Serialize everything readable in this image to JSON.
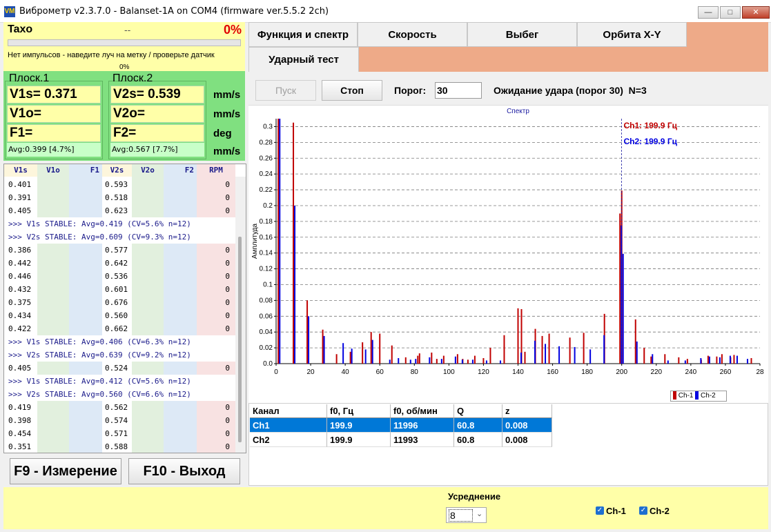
{
  "window": {
    "title": "Виброметр v2.3.7.0 - Balanset-1A on COM4 (firmware ver.5.5.2 2ch)",
    "icon": "VM",
    "controls": [
      "minimize",
      "maximize",
      "close"
    ]
  },
  "taxo": {
    "title": "Taxo",
    "rpm": "--",
    "percent": "0%",
    "message": "Нет импульсов - наведите луч на метку / проверьте датчик",
    "bar_percent_label": "0%",
    "bar_fill": 0
  },
  "plane1": {
    "title": "Плоск.1",
    "v1s": "V1s= 0.371",
    "v1o": "V1o=",
    "f1": "F1=",
    "avg": "Avg:0.399 [4.7%]"
  },
  "plane2": {
    "title": "Плоск.2",
    "v2s": "V2s= 0.539",
    "v2o": "V2o=",
    "f2": "F2=",
    "avg": "Avg:0.567 [7.7%]"
  },
  "units": [
    "mm/s",
    "mm/s",
    "deg",
    "mm/s"
  ],
  "log_table": {
    "columns": [
      "V1s",
      "V1o",
      "F1",
      "V2s",
      "V2o",
      "F2",
      "RPM"
    ],
    "rows": [
      {
        "type": "data",
        "v1s": "0.401",
        "v2s": "0.593",
        "rpm": "0"
      },
      {
        "type": "data",
        "v1s": "0.391",
        "v2s": "0.518",
        "rpm": "0"
      },
      {
        "type": "data",
        "v1s": "0.405",
        "v2s": "0.623",
        "rpm": "0"
      },
      {
        "type": "msg",
        "text": ">>> V1s STABLE: Avg=0.419 (CV=5.6% n=12)"
      },
      {
        "type": "msg",
        "text": ">>> V2s STABLE: Avg=0.609 (CV=9.3% n=12)"
      },
      {
        "type": "data",
        "v1s": "0.386",
        "v2s": "0.577",
        "rpm": "0"
      },
      {
        "type": "data",
        "v1s": "0.442",
        "v2s": "0.642",
        "rpm": "0"
      },
      {
        "type": "data",
        "v1s": "0.446",
        "v2s": "0.536",
        "rpm": "0"
      },
      {
        "type": "data",
        "v1s": "0.432",
        "v2s": "0.601",
        "rpm": "0"
      },
      {
        "type": "data",
        "v1s": "0.375",
        "v2s": "0.676",
        "rpm": "0"
      },
      {
        "type": "data",
        "v1s": "0.434",
        "v2s": "0.560",
        "rpm": "0"
      },
      {
        "type": "data",
        "v1s": "0.422",
        "v2s": "0.662",
        "rpm": "0"
      },
      {
        "type": "msg",
        "text": ">>> V1s STABLE: Avg=0.406 (CV=6.3% n=12)"
      },
      {
        "type": "msg",
        "text": ">>> V2s STABLE: Avg=0.639 (CV=9.2% n=12)"
      },
      {
        "type": "data",
        "v1s": "0.405",
        "v2s": "0.524",
        "rpm": "0"
      },
      {
        "type": "msg",
        "text": ">>> V1s STABLE: Avg=0.412 (CV=5.6% n=12)"
      },
      {
        "type": "msg",
        "text": ">>> V2s STABLE: Avg=0.560 (CV=6.6% n=12)"
      },
      {
        "type": "data",
        "v1s": "0.419",
        "v2s": "0.562",
        "rpm": "0"
      },
      {
        "type": "data",
        "v1s": "0.398",
        "v2s": "0.574",
        "rpm": "0"
      },
      {
        "type": "data",
        "v1s": "0.454",
        "v2s": "0.571",
        "rpm": "0"
      },
      {
        "type": "data",
        "v1s": "0.351",
        "v2s": "0.588",
        "rpm": "0"
      }
    ]
  },
  "fkeys": {
    "measure": "F9 - Измерение",
    "exit": "F10 - Выход"
  },
  "tabs": {
    "func_spectrum": "Функция и спектр",
    "speed": "Скорость",
    "rundown": "Выбег",
    "orbit": "Орбита X-Y",
    "impact": "Ударный тест"
  },
  "toolbar": {
    "start": "Пуск",
    "stop": "Стоп",
    "threshold_label": "Порог:",
    "threshold_value": "30",
    "status": "Ожидание удара (порог 30)  N=3"
  },
  "results": {
    "columns": [
      "Канал",
      "f0, Гц",
      "f0, об/мин",
      "Q",
      "z"
    ],
    "rows": [
      [
        "Ch1",
        "199.9",
        "11996",
        "60.8",
        "0.008"
      ],
      [
        "Ch2",
        "199.9",
        "11993",
        "60.8",
        "0.008"
      ]
    ],
    "selected_row": 0
  },
  "bottom": {
    "averaging_label": "Усреднение",
    "averaging_value": "8",
    "ch1_label": "Ch-1",
    "ch2_label": "Ch-2",
    "ch1_checked": true,
    "ch2_checked": true
  },
  "colors": {
    "ch1": "#c00000",
    "ch2": "#0000e0",
    "yellow_panel": "#ffffa8",
    "green_panel": "#80e080",
    "tab_bg": "#eeaa88",
    "red_text": "#e00000",
    "selection": "#0078d7"
  },
  "chart_data": {
    "type": "bar",
    "title": "Спектр",
    "xlabel": "",
    "ylabel": "Амплитуда",
    "xlim": [
      0,
      280
    ],
    "ylim": [
      0,
      0.31
    ],
    "xticks": [
      "0",
      "20",
      "40",
      "60",
      "80",
      "100",
      "120",
      "140",
      "160",
      "180",
      "200",
      "220",
      "240",
      "260",
      "28"
    ],
    "yticks": [
      "0.0",
      "0.02",
      "0.04",
      "0.06",
      "0.08",
      "0.1",
      "0.12",
      "0.14",
      "0.16",
      "0.18",
      "0.2",
      "0.22",
      "0.24",
      "0.26",
      "0.28",
      "0.3"
    ],
    "grid": true,
    "legend": "bottom-right",
    "cursor": {
      "x": 199.9,
      "label_ch1": "Ch1: 199.9 Гц",
      "label_ch2": "Ch2: 199.9 Гц"
    },
    "series": [
      {
        "name": "Ch-1",
        "x": [
          1.3,
          10,
          18,
          27,
          35,
          43,
          50,
          55,
          60,
          67,
          75,
          82,
          83,
          90,
          93,
          97,
          105,
          108,
          111,
          115,
          120,
          124,
          132,
          140,
          142,
          144,
          150,
          154,
          158,
          170,
          178,
          190,
          199,
          200,
          208,
          213,
          217,
          225,
          233,
          238,
          246,
          250,
          255,
          258,
          263,
          265,
          275
        ],
        "values": [
          0.31,
          0.305,
          0.08,
          0.043,
          0.012,
          0.015,
          0.027,
          0.04,
          0.038,
          0.023,
          0.008,
          0.01,
          0.013,
          0.014,
          0.006,
          0.01,
          0.012,
          0.006,
          0.005,
          0.01,
          0.007,
          0.02,
          0.036,
          0.07,
          0.069,
          0.015,
          0.044,
          0.035,
          0.038,
          0.033,
          0.039,
          0.063,
          0.19,
          0.219,
          0.056,
          0.02,
          0.009,
          0.012,
          0.008,
          0.006,
          0.005,
          0.01,
          0.009,
          0.012,
          0.008,
          0.011,
          0.007
        ]
      },
      {
        "name": "Ch-2",
        "x": [
          1.3,
          10,
          18,
          27,
          38,
          43,
          51,
          55,
          65,
          70,
          77,
          80,
          88,
          95,
          103,
          107,
          113,
          121,
          129,
          141,
          149,
          155,
          163,
          172,
          181,
          189,
          199,
          200,
          208,
          217,
          226,
          236,
          245,
          250,
          256,
          262,
          266,
          272
        ],
        "values": [
          0.31,
          0.2,
          0.06,
          0.035,
          0.026,
          0.019,
          0.018,
          0.03,
          0.005,
          0.007,
          0.005,
          0.006,
          0.008,
          0.006,
          0.009,
          0.005,
          0.005,
          0.004,
          0.004,
          0.014,
          0.029,
          0.025,
          0.022,
          0.021,
          0.018,
          0.036,
          0.175,
          0.139,
          0.028,
          0.012,
          0.004,
          0.004,
          0.007,
          0.009,
          0.008,
          0.01,
          0.01,
          0.006
        ]
      }
    ]
  }
}
